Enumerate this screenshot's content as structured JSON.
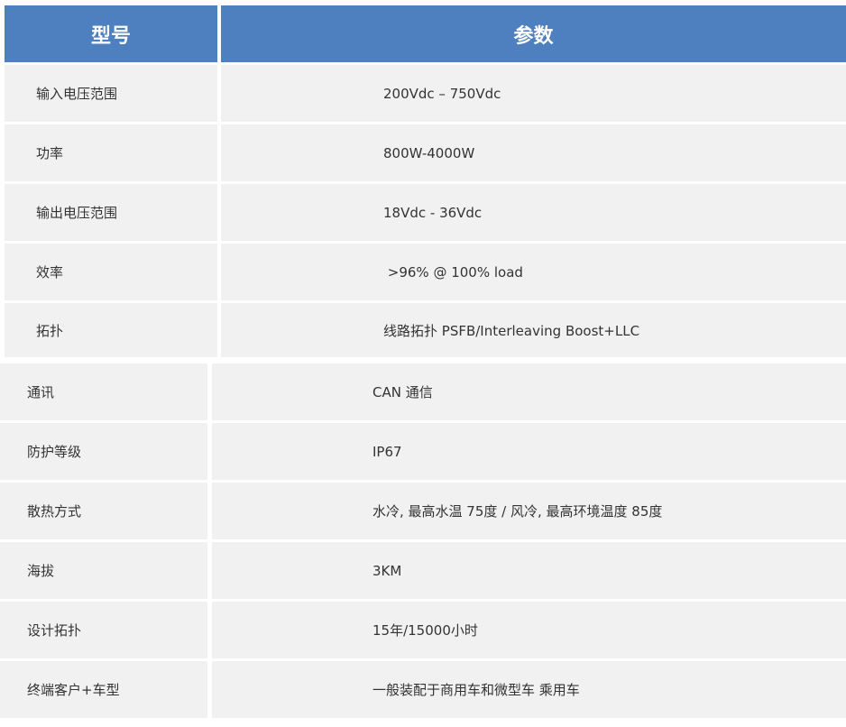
{
  "table": {
    "header": {
      "col1": "型号",
      "col2": "参数"
    },
    "rows_top": [
      {
        "label": "输入电压范围",
        "value": "200Vdc – 750Vdc"
      },
      {
        "label": "功率",
        "value": "800W-4000W"
      },
      {
        "label": "输出电压范围",
        "value": "18Vdc - 36Vdc"
      },
      {
        "label": "效率",
        "value": " >96% @ 100% load"
      },
      {
        "label": "拓扑",
        "value": "线路拓扑 PSFB/Interleaving Boost+LLC"
      }
    ],
    "rows_bottom": [
      {
        "label": "通讯",
        "value": "CAN 通信"
      },
      {
        "label": "防护等级",
        "value": "IP67"
      },
      {
        "label": "散热方式",
        "value": "水冷, 最高水温 75度 / 风冷, 最高环境温度 85度"
      },
      {
        "label": "海拔",
        "value": "3KM"
      },
      {
        "label": "设计拓扑",
        "value": "15年/15000小时"
      },
      {
        "label": "终端客户+车型",
        "value": "一般装配于商用车和微型车 乘用车"
      }
    ]
  }
}
